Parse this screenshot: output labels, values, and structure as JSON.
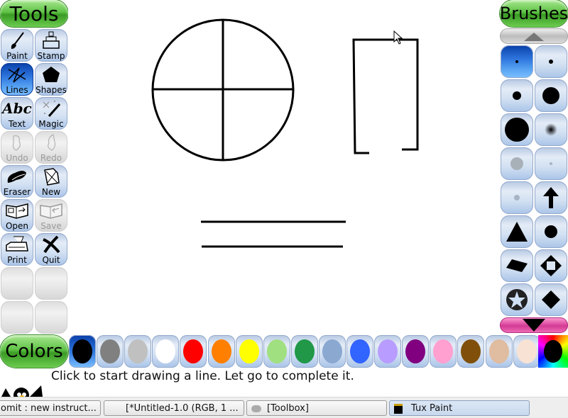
{
  "app": {
    "name": "Tux Paint"
  },
  "tools_panel": {
    "title": "Tools",
    "tools": [
      {
        "label": "Paint",
        "icon": "paintbrush-icon",
        "state": "normal"
      },
      {
        "label": "Stamp",
        "icon": "stamp-icon",
        "state": "normal"
      },
      {
        "label": "Lines",
        "icon": "lines-icon",
        "state": "selected"
      },
      {
        "label": "Shapes",
        "icon": "pentagon-icon",
        "state": "normal"
      },
      {
        "label": "Text",
        "icon": "text-abc-icon",
        "glyph": "Abc",
        "state": "normal"
      },
      {
        "label": "Magic",
        "icon": "magic-wand-icon",
        "state": "normal"
      },
      {
        "label": "Undo",
        "icon": "undo-hand-icon",
        "state": "disabled"
      },
      {
        "label": "Redo",
        "icon": "redo-hand-icon",
        "state": "disabled"
      },
      {
        "label": "Eraser",
        "icon": "eraser-icon",
        "state": "normal"
      },
      {
        "label": "New",
        "icon": "new-page-icon",
        "state": "normal"
      },
      {
        "label": "Open",
        "icon": "open-book-icon",
        "state": "normal"
      },
      {
        "label": "Save",
        "icon": "save-book-icon",
        "state": "disabled"
      },
      {
        "label": "Print",
        "icon": "printer-icon",
        "state": "normal"
      },
      {
        "label": "Quit",
        "icon": "quit-x-icon",
        "state": "normal"
      }
    ]
  },
  "brushes_panel": {
    "title": "Brushes",
    "scroll_up_icon": "triangle-up-icon",
    "scroll_down_icon": "triangle-down-icon",
    "brushes": [
      {
        "name": "tiny-dot",
        "selected": true
      },
      {
        "name": "small-dot"
      },
      {
        "name": "medium-dot"
      },
      {
        "name": "large-dot"
      },
      {
        "name": "huge-dot"
      },
      {
        "name": "fuzzy-dot"
      },
      {
        "name": "gray-soft-dot"
      },
      {
        "name": "gray-tiny-dot"
      },
      {
        "name": "gray-small-dot"
      },
      {
        "name": "arrow-up"
      },
      {
        "name": "triangle"
      },
      {
        "name": "circle"
      },
      {
        "name": "parallelogram"
      },
      {
        "name": "diamond-square"
      },
      {
        "name": "star-circle"
      },
      {
        "name": "diamond"
      }
    ]
  },
  "colors_panel": {
    "title": "Colors",
    "colors": [
      {
        "name": "black",
        "hex": "#000000",
        "selected": true
      },
      {
        "name": "gray",
        "hex": "#808080"
      },
      {
        "name": "silver",
        "hex": "#c0c0c0"
      },
      {
        "name": "white",
        "hex": "#ffffff"
      },
      {
        "name": "red",
        "hex": "#ff0000"
      },
      {
        "name": "orange",
        "hex": "#ff8000"
      },
      {
        "name": "yellow",
        "hex": "#ffff00"
      },
      {
        "name": "light-green",
        "hex": "#a0e080"
      },
      {
        "name": "green",
        "hex": "#209848"
      },
      {
        "name": "steel-blue",
        "hex": "#8aa8d0"
      },
      {
        "name": "blue",
        "hex": "#3264ff"
      },
      {
        "name": "lavender",
        "hex": "#b89cff"
      },
      {
        "name": "purple",
        "hex": "#800080"
      },
      {
        "name": "pink",
        "hex": "#ffa0d0"
      },
      {
        "name": "brown",
        "hex": "#80500a"
      },
      {
        "name": "tan",
        "hex": "#e0bca0"
      },
      {
        "name": "peach",
        "hex": "#f8e2d4"
      }
    ],
    "picker_icon": "color-picker-icon"
  },
  "status": {
    "message": "Click to start drawing a line. Let go to complete it."
  },
  "taskbar": {
    "items": [
      {
        "label": "omit : new instruct...",
        "active": false
      },
      {
        "label": "[*Untitled-1.0 (RGB, 1 ...",
        "active": false
      },
      {
        "label": "[Toolbox]",
        "icon": "gimp-icon",
        "active": false
      },
      {
        "label": "Tux Paint",
        "icon": "tux-paint-icon",
        "active": true
      }
    ]
  }
}
